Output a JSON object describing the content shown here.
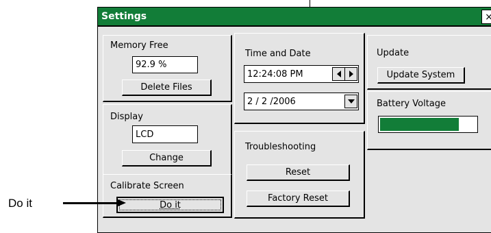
{
  "window": {
    "title": "Settings",
    "close_symbol": "×"
  },
  "memory": {
    "label": "Memory Free",
    "value": "92.9 %",
    "delete_button": "Delete Files"
  },
  "display": {
    "label": "Display",
    "value": "LCD",
    "change_button": "Change"
  },
  "calibrate": {
    "label": "Calibrate Screen",
    "do_it_button": "Do it"
  },
  "time_date": {
    "label": "Time and Date",
    "time": "12:24:08 PM",
    "date": "2 / 2 /2006"
  },
  "troubleshooting": {
    "label": "Troubleshooting",
    "reset_button": "Reset",
    "factory_reset_button": "Factory Reset"
  },
  "update": {
    "label": "Update",
    "update_button": "Update System"
  },
  "battery": {
    "label": "Battery Voltage",
    "level_fraction": 0.82,
    "fill_color": "#127d38"
  },
  "callout": {
    "text": "Do it"
  },
  "colors": {
    "titlebar": "#127d38",
    "panel": "#e4e4e4"
  },
  "icons": {
    "close": "close-icon",
    "spin_left": "arrow-left-icon",
    "spin_right": "arrow-right-icon",
    "dropdown": "chevron-down-icon"
  }
}
